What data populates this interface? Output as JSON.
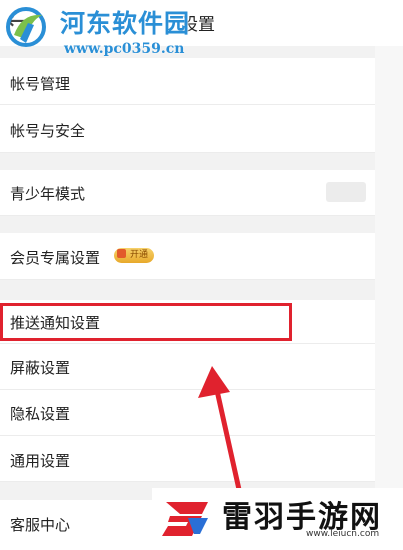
{
  "header": {
    "title": "设置",
    "back_icon": "back-arrow-icon"
  },
  "watermark": {
    "site_name": "河东软件园",
    "site_url": "www.pc0359.cn"
  },
  "settings": {
    "items": [
      {
        "label": "帐号管理"
      },
      {
        "label": "帐号与安全"
      },
      {
        "label": "青少年模式"
      },
      {
        "label": "会员专属设置",
        "badge": "开通"
      },
      {
        "label": "推送通知设置"
      },
      {
        "label": "屏蔽设置"
      },
      {
        "label": "隐私设置"
      },
      {
        "label": "通用设置"
      },
      {
        "label": "客服中心"
      }
    ]
  },
  "annotation": {
    "highlight_color": "#e0222e",
    "arrow_color": "#e0222e"
  },
  "brand": {
    "name": "雷羽手游网",
    "url": "www.leiucn.com"
  }
}
